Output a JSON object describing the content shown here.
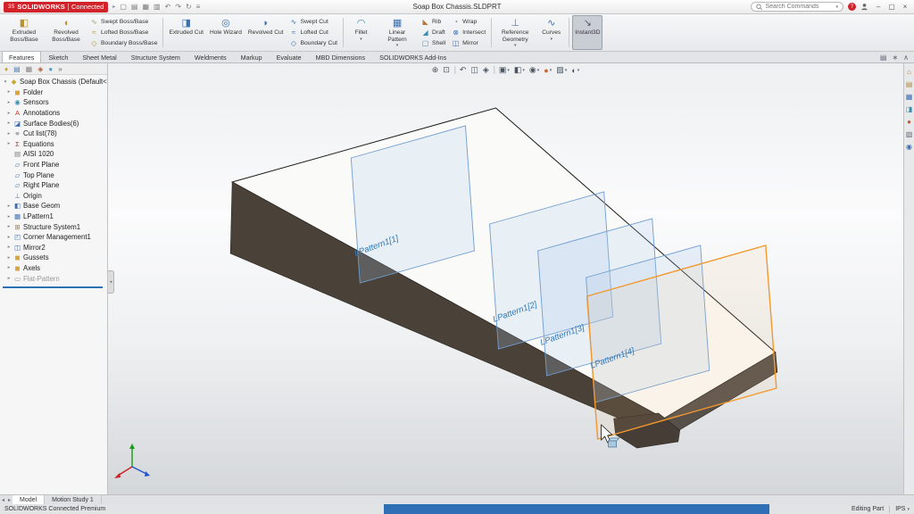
{
  "colors": {
    "accent_red": "#d2232a",
    "plane_blue": "#6f9dcf",
    "selection_orange": "#f2982f",
    "rollback_blue": "#2f6fb5"
  },
  "titlebar": {
    "logo_mark": "3S",
    "logo_primary": "SOLIDWORKS",
    "logo_secondary": "Connected",
    "menu_arrow": "▸",
    "document_title": "Soap Box Chassis.SLDPRT",
    "search_placeholder": "Search Commands",
    "search_caret": "▾",
    "help_glyph": "?",
    "quick_icons": [
      {
        "name": "new-file-icon",
        "glyph": "▢"
      },
      {
        "name": "open-file-icon",
        "glyph": "▤"
      },
      {
        "name": "save-icon",
        "glyph": "▦"
      },
      {
        "name": "print-icon",
        "glyph": "▥"
      },
      {
        "name": "undo-icon",
        "glyph": "↶"
      },
      {
        "name": "redo-icon",
        "glyph": "↷"
      },
      {
        "name": "rebuild-icon",
        "glyph": "↻"
      },
      {
        "name": "options-icon",
        "glyph": "≡"
      }
    ],
    "window_controls": [
      {
        "name": "minimize-button",
        "glyph": "–"
      },
      {
        "name": "maximize-button",
        "glyph": "▢"
      },
      {
        "name": "close-button",
        "glyph": "×"
      }
    ]
  },
  "ribbon": {
    "groups": [
      {
        "big": [
          {
            "label": "Extruded Boss/Base",
            "glyph": "◧",
            "color": "#b8922f"
          },
          {
            "label": "Revolved Boss/Base",
            "glyph": "◖",
            "color": "#b8922f"
          }
        ],
        "stacks": [
          [
            {
              "label": "Swept Boss/Base",
              "glyph": "∿",
              "color": "#b8922f"
            },
            {
              "label": "Lofted Boss/Base",
              "glyph": "≈",
              "color": "#b8922f"
            },
            {
              "label": "Boundary Boss/Base",
              "glyph": "◇",
              "color": "#b8922f"
            }
          ]
        ]
      },
      {
        "big": [
          {
            "label": "Extruded Cut",
            "glyph": "◨",
            "color": "#3a6fb0"
          },
          {
            "label": "Hole Wizard",
            "glyph": "◎",
            "color": "#3a6fb0"
          },
          {
            "label": "Revolved Cut",
            "glyph": "◗",
            "color": "#3a6fb0"
          }
        ],
        "stacks": [
          [
            {
              "label": "Swept Cut",
              "glyph": "∿",
              "color": "#3a6fb0"
            },
            {
              "label": "Lofted Cut",
              "glyph": "≈",
              "color": "#3a6fb0"
            },
            {
              "label": "Boundary Cut",
              "glyph": "◇",
              "color": "#3a6fb0"
            }
          ]
        ]
      },
      {
        "big": [
          {
            "label": "Fillet",
            "glyph": "◠",
            "color": "#3a8fb0",
            "caret": true
          },
          {
            "label": "Linear Pattern",
            "glyph": "▦",
            "color": "#3a6fb0",
            "caret": true
          }
        ],
        "stacks": [
          [
            {
              "label": "Rib",
              "glyph": "◣",
              "color": "#b0783a"
            },
            {
              "label": "Draft",
              "glyph": "◢",
              "color": "#3a8fb0"
            },
            {
              "label": "Shell",
              "glyph": "▢",
              "color": "#3a8fb0"
            }
          ],
          [
            {
              "label": "Wrap",
              "glyph": "◔",
              "color": "#3a8fb0"
            },
            {
              "label": "Intersect",
              "glyph": "⊗",
              "color": "#3a6fb0"
            },
            {
              "label": "Mirror",
              "glyph": "◫",
              "color": "#3a6fb0"
            }
          ]
        ]
      },
      {
        "big": [
          {
            "label": "Reference Geometry",
            "glyph": "⊥",
            "color": "#5577aa",
            "caret": true
          },
          {
            "label": "Curves",
            "glyph": "∿",
            "color": "#3a6fb0",
            "caret": true
          }
        ]
      },
      {
        "big": [
          {
            "label": "Instant3D",
            "glyph": "↘",
            "color": "#555b66",
            "active": true
          }
        ]
      }
    ]
  },
  "tabs": {
    "labels": [
      "Features",
      "Sketch",
      "Sheet Metal",
      "Structure System",
      "Weldments",
      "Markup",
      "Evaluate",
      "MBD Dimensions",
      "SOLIDWORKS Add-Ins"
    ],
    "active_index": 0
  },
  "tabrow_icons": [
    {
      "name": "ribbon-options",
      "glyph": "▤"
    },
    {
      "name": "pin-ribbon",
      "glyph": "∗"
    },
    {
      "name": "collapse-ribbon",
      "glyph": "∧"
    }
  ],
  "headsup": [
    {
      "name": "zoom-to-fit",
      "glyph": "⊕"
    },
    {
      "name": "zoom-to-area",
      "glyph": "⊡"
    },
    {
      "sep": true
    },
    {
      "name": "previous-view",
      "glyph": "↶"
    },
    {
      "name": "section-view",
      "glyph": "◫"
    },
    {
      "name": "dynamic-annotation-views",
      "glyph": "◈"
    },
    {
      "sep": true
    },
    {
      "name": "view-orientation",
      "glyph": "▣",
      "caret": true
    },
    {
      "name": "display-style",
      "glyph": "◧",
      "caret": true
    },
    {
      "name": "hide-show-items",
      "glyph": "◉",
      "caret": true
    },
    {
      "name": "edit-appearance",
      "glyph": "●",
      "color": "#cc6633",
      "caret": true
    },
    {
      "name": "apply-scene",
      "glyph": "▨",
      "caret": true
    },
    {
      "name": "view-settings",
      "glyph": "◐",
      "caret": true
    }
  ],
  "panel": {
    "tabs": [
      {
        "name": "featuremanager-tab",
        "glyph": "♦",
        "color": "#caa43c"
      },
      {
        "name": "propertymanager-tab",
        "glyph": "▤",
        "color": "#4a7fb5"
      },
      {
        "name": "configurationmanager-tab",
        "glyph": "▦",
        "color": "#888888"
      },
      {
        "name": "dimxpertmanager-tab",
        "glyph": "◈",
        "color": "#b05a3a"
      },
      {
        "name": "displaymanager-tab",
        "glyph": "●",
        "color": "#4a9fd0"
      },
      {
        "name": "panel-chevron-icon",
        "glyph": "»",
        "color": "#666666"
      }
    ],
    "root": {
      "label": "Soap Box Chassis (Default< As Machin",
      "glyph": "◆",
      "color": "#caa43c",
      "arrow": "▾"
    },
    "items": [
      {
        "label": "Folder",
        "icon": "folder-icon",
        "glyph": "◼",
        "color": "#d9a43c",
        "expand": true
      },
      {
        "label": "Sensors",
        "icon": "sensors-icon",
        "glyph": "◉",
        "color": "#3a8fb0",
        "expand": true
      },
      {
        "label": "Annotations",
        "icon": "annotations-icon",
        "glyph": "A",
        "color": "#c0392b",
        "expand": true
      },
      {
        "label": "Surface Bodies(6)",
        "icon": "surface-bodies-icon",
        "glyph": "◪",
        "color": "#3a6fb0",
        "expand": true
      },
      {
        "label": "Cut list(78)",
        "icon": "cut-list-icon",
        "glyph": "≡",
        "color": "#666677",
        "expand": true
      },
      {
        "label": "Equations",
        "icon": "equations-icon",
        "glyph": "Σ",
        "color": "#a03a3a",
        "expand": true
      },
      {
        "label": "AISI 1020",
        "icon": "material-icon",
        "glyph": "▤",
        "color": "#777777",
        "expand": false
      },
      {
        "label": "Front Plane",
        "icon": "plane-icon",
        "glyph": "▱",
        "color": "#4a7fb5",
        "expand": false
      },
      {
        "label": "Top Plane",
        "icon": "plane-icon",
        "glyph": "▱",
        "color": "#4a7fb5",
        "expand": false
      },
      {
        "label": "Right Plane",
        "icon": "plane-icon",
        "glyph": "▱",
        "color": "#4a7fb5",
        "expand": false
      },
      {
        "label": "Origin",
        "icon": "origin-icon",
        "glyph": "⊥",
        "color": "#4a7fb5",
        "expand": false
      },
      {
        "label": "Base Geom",
        "icon": "base-geom-icon",
        "glyph": "◧",
        "color": "#3a6fb0",
        "expand": true
      },
      {
        "label": "LPattern1",
        "icon": "linear-pattern-icon",
        "glyph": "▦",
        "color": "#3a6fb0",
        "expand": true
      },
      {
        "label": "Structure System1",
        "icon": "structure-system-icon",
        "glyph": "⊞",
        "color": "#b0783a",
        "expand": true
      },
      {
        "label": "Corner Management1",
        "icon": "corner-management-icon",
        "glyph": "◰",
        "color": "#3a6fb0",
        "expand": true
      },
      {
        "label": "Mirror2",
        "icon": "mirror-icon",
        "glyph": "◫",
        "color": "#3a6fb0",
        "expand": true
      },
      {
        "label": "Gussets",
        "icon": "folder-icon",
        "glyph": "◼",
        "color": "#d9a43c",
        "expand": true
      },
      {
        "label": "Axels",
        "icon": "folder-icon",
        "glyph": "◼",
        "color": "#d9a43c",
        "expand": true
      },
      {
        "label": "Flat-Pattern",
        "icon": "flat-pattern-icon",
        "glyph": "▭",
        "color": "#999999",
        "expand": true,
        "dim": true
      }
    ]
  },
  "viewport": {
    "plane_labels": [
      "LPattern1[1]",
      "LPattern1[2]",
      "LPattern1[3]",
      "LPattern1[4]"
    ]
  },
  "taskpane": [
    {
      "name": "solidworks-resources",
      "glyph": "⌂",
      "color": "#c8782a"
    },
    {
      "name": "design-library",
      "glyph": "▤",
      "color": "#b08a3a"
    },
    {
      "name": "file-explorer",
      "glyph": "▦",
      "color": "#3a6fb0"
    },
    {
      "name": "view-palette",
      "glyph": "◨",
      "color": "#3a8fb0"
    },
    {
      "name": "appearances-scenes",
      "glyph": "●",
      "color": "#cc5533"
    },
    {
      "name": "custom-properties",
      "glyph": "▧",
      "color": "#666677"
    },
    {
      "name": "forum",
      "glyph": "◉",
      "color": "#3a6fb0"
    }
  ],
  "bottom": {
    "nav": [
      {
        "name": "tab-scroll-left",
        "glyph": "◂"
      },
      {
        "name": "tab-scroll-right",
        "glyph": "▸"
      }
    ],
    "tabs": [
      "Model",
      "Motion Study 1"
    ],
    "active_index": 0
  },
  "statusbar": {
    "product": "SOLIDWORKS Connected Premium",
    "mode": "Editing Part",
    "units": "IPS"
  }
}
